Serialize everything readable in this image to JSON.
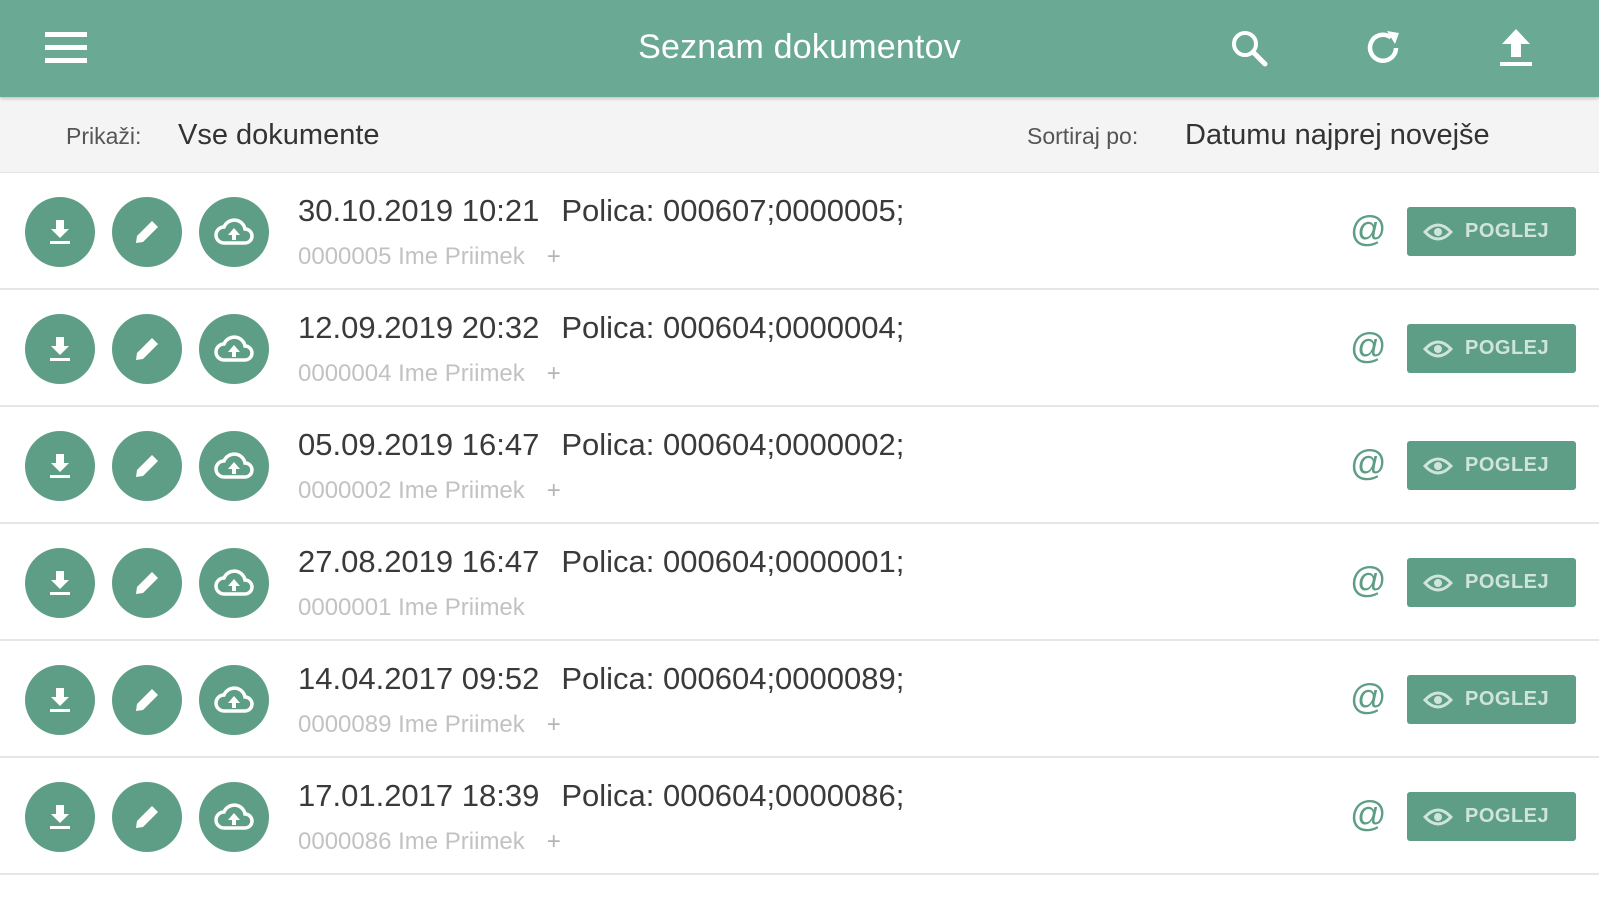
{
  "header": {
    "title": "Seznam dokumentov",
    "menu_icon": "hamburger-menu-icon",
    "search_icon": "search-icon",
    "refresh_icon": "refresh-icon",
    "upload_icon": "upload-icon",
    "color": "#6aa994"
  },
  "filters": {
    "show_label": "Prikaži:",
    "show_value": "Vse dokumente",
    "sort_label": "Sortiraj po:",
    "sort_value": "Datumu najprej novejše"
  },
  "documents": [
    {
      "datetime": "30.10.2019 10:21",
      "policy": "Polica: 000607;0000005;",
      "subtitle": "0000005 Ime Priimek",
      "extra": "+",
      "email": "@",
      "view_label": "POGLEJ"
    },
    {
      "datetime": "12.09.2019 20:32",
      "policy": "Polica: 000604;0000004;",
      "subtitle": "0000004 Ime Priimek",
      "extra": "+",
      "email": "@",
      "view_label": "POGLEJ"
    },
    {
      "datetime": "05.09.2019 16:47",
      "policy": "Polica: 000604;0000002;",
      "subtitle": "0000002 Ime Priimek",
      "extra": "+",
      "email": "@",
      "view_label": "POGLEJ"
    },
    {
      "datetime": "27.08.2019 16:47",
      "policy": "Polica: 000604;0000001;",
      "subtitle": "0000001 Ime Priimek",
      "extra": "",
      "email": "@",
      "view_label": "POGLEJ"
    },
    {
      "datetime": "14.04.2017 09:52",
      "policy": "Polica: 000604;0000089;",
      "subtitle": "0000089 Ime Priimek",
      "extra": "+",
      "email": "@",
      "view_label": "POGLEJ"
    },
    {
      "datetime": "17.01.2017 18:39",
      "policy": "Polica: 000604;0000086;",
      "subtitle": "0000086 Ime Priimek",
      "extra": "+",
      "email": "@",
      "view_label": "POGLEJ"
    }
  ],
  "row_icons": {
    "download": "download-icon",
    "edit": "pencil-icon",
    "cloud": "cloud-upload-icon",
    "view": "eye-icon"
  },
  "accent_color": "#5f9e86"
}
